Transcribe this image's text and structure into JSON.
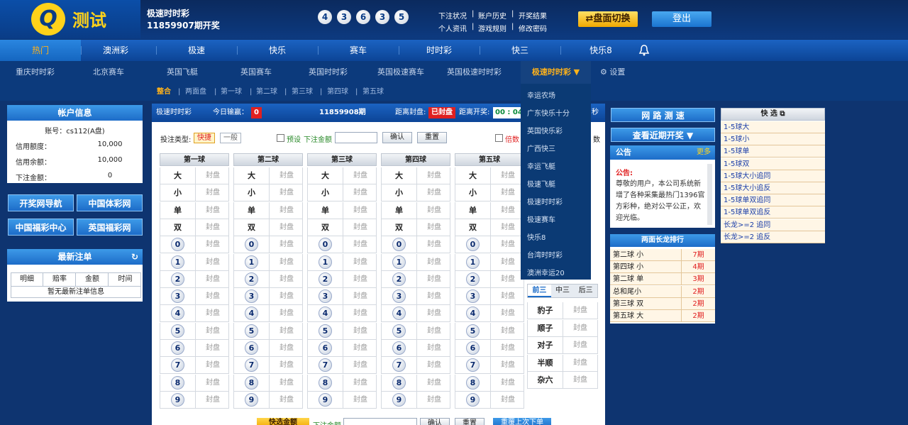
{
  "header": {
    "logo_letter": "Q",
    "app_title": "测试",
    "game_name": "极速时时彩",
    "issue_text": "11859907期开奖",
    "last_result": [
      "4",
      "3",
      "6",
      "3",
      "5"
    ],
    "links": [
      "下注状况",
      "账户历史",
      "开奖结果",
      "个人资讯",
      "游戏规则",
      "修改密码"
    ],
    "switch_label": "⇄盘面切换",
    "logout_label": "登出"
  },
  "main_nav": [
    "热门",
    "澳洲彩",
    "极速",
    "快乐",
    "赛车",
    "时时彩",
    "快三",
    "快乐8"
  ],
  "sub_nav": [
    "重庆时时彩",
    "北京赛车",
    "英国飞艇",
    "英国赛车",
    "英国时时彩",
    "英国极速赛车",
    "英国极速时时彩",
    "极速时时彩 ▼"
  ],
  "settings_label": "设置",
  "sub_sub": [
    "整合",
    "两面盘",
    "第一球",
    "第二球",
    "第三球",
    "第四球",
    "第五球"
  ],
  "account": {
    "title": "帐户信息",
    "account_label": "账号：cs112(A盘)",
    "rows": [
      {
        "label": "信用额度：",
        "value": "10,000"
      },
      {
        "label": "信用余额：",
        "value": "10,000"
      },
      {
        "label": "下注金额：",
        "value": "0"
      }
    ]
  },
  "side_links": [
    "开奖网导航",
    "中国体彩网",
    "中国福彩中心",
    "英国福彩网"
  ],
  "latest": {
    "title": "最新注单",
    "cols": [
      "明细",
      "赔率",
      "金额",
      "时间"
    ],
    "empty": "暂无最新注单信息"
  },
  "panel": {
    "game": "极速时时彩",
    "today_label": "今日输赢：",
    "today_value": "0",
    "issue": "11859908期",
    "close_label": "距离封盘:",
    "close_value": "已封盘",
    "open_label": "距离开奖:",
    "open_value": "00 : 04",
    "sec": "秒",
    "bet_type_label": "投注类型:",
    "fast_label": "快捷",
    "normal_label": "一般",
    "preset_label": "预设",
    "amount_label": "下注金额",
    "confirm_label": "确认",
    "reset_label": "重置",
    "multiple_label": "倍数",
    "count_label": "数",
    "columns": [
      "第一球",
      "第二球",
      "第三球",
      "第四球",
      "第五球"
    ],
    "row_labels": [
      "大",
      "小",
      "单",
      "双"
    ],
    "numbers": [
      "0",
      "1",
      "2",
      "3",
      "4",
      "5",
      "6",
      "7",
      "8",
      "9"
    ],
    "closed": "封盘",
    "side_tabs": [
      "前三",
      "中三",
      "后三"
    ],
    "side_rows": [
      "豹子",
      "顺子",
      "对子",
      "半顺",
      "杂六"
    ],
    "bottom_fast": "快选金额",
    "bottom_amount": "下注金额",
    "bottom_confirm": "确认",
    "bottom_reset": "重置",
    "bottom_repeat": "重覆上次下单"
  },
  "dropdown": [
    "幸运农场",
    "广东快乐十分",
    "英国快乐彩",
    "广西快三",
    "幸运飞艇",
    "极速飞艇",
    "极速时时彩",
    "极速赛车",
    "快乐8",
    "台湾时时彩",
    "澳洲幸运20"
  ],
  "right": {
    "speed_label": "网 路 测 速",
    "recent_label": "查看近期开奖 ▼",
    "notice_title": "公告",
    "notice_more": "更多",
    "notice_head": "公告:",
    "notice_body": "尊敬的用户，本公司系统新增了各种采集最热门1396官方彩种，绝对公平公正，欢迎光临。",
    "ranking_title": "两面长龙排行",
    "ranking": [
      {
        "name": "第二球 小",
        "period": "7期"
      },
      {
        "name": "第四球 小",
        "period": "4期"
      },
      {
        "name": "第二球 单",
        "period": "3期"
      },
      {
        "name": "总和尾小",
        "period": "2期"
      },
      {
        "name": "第三球 双",
        "period": "2期"
      },
      {
        "name": "第五球 大",
        "period": "2期"
      }
    ],
    "quick_title": "快 选",
    "quick": [
      "1-5球大",
      "1-5球小",
      "1-5球单",
      "1-5球双",
      "1-5球大小追同",
      "1-5球大小追反",
      "1-5球单双追同",
      "1-5球单双追反",
      "长龙>=2 追同",
      "长龙>=2 追反"
    ]
  }
}
